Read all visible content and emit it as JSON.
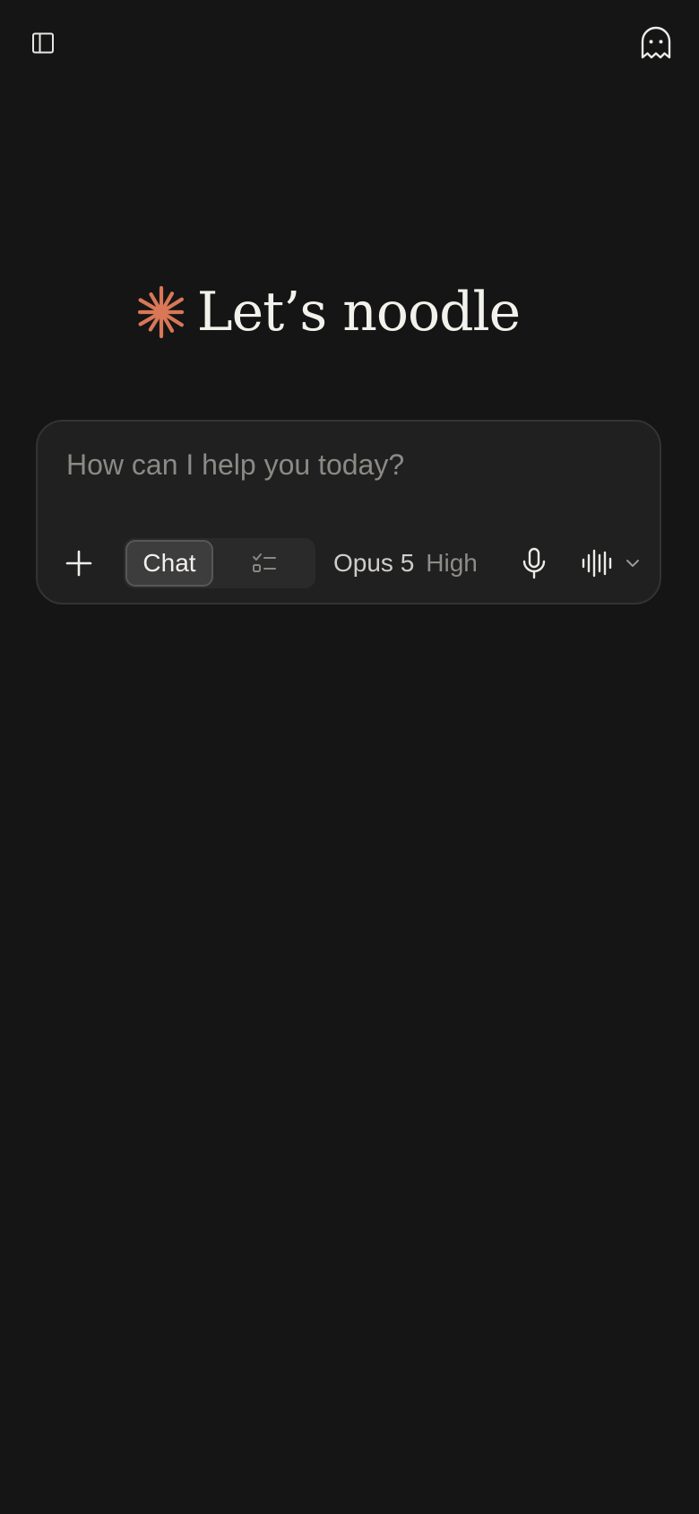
{
  "greeting": {
    "text": "Let’s noodle",
    "accent_color": "#d97757"
  },
  "composer": {
    "placeholder": "How can I help you today?",
    "mode_toggle": {
      "chat_label": "Chat",
      "selected": "Chat",
      "other_mode_icon": "task-list-icon"
    },
    "model": {
      "name": "Opus 5",
      "effort": "High"
    }
  },
  "icons": {
    "top_left": "sidebar-toggle-icon",
    "top_right": "ghost-icon",
    "add": "plus-icon",
    "mic": "microphone-icon",
    "voice": "waveform-icon",
    "dropdown": "chevron-down-icon"
  },
  "colors": {
    "background": "#151515",
    "composer": "#202020",
    "accent": "#d97757"
  }
}
